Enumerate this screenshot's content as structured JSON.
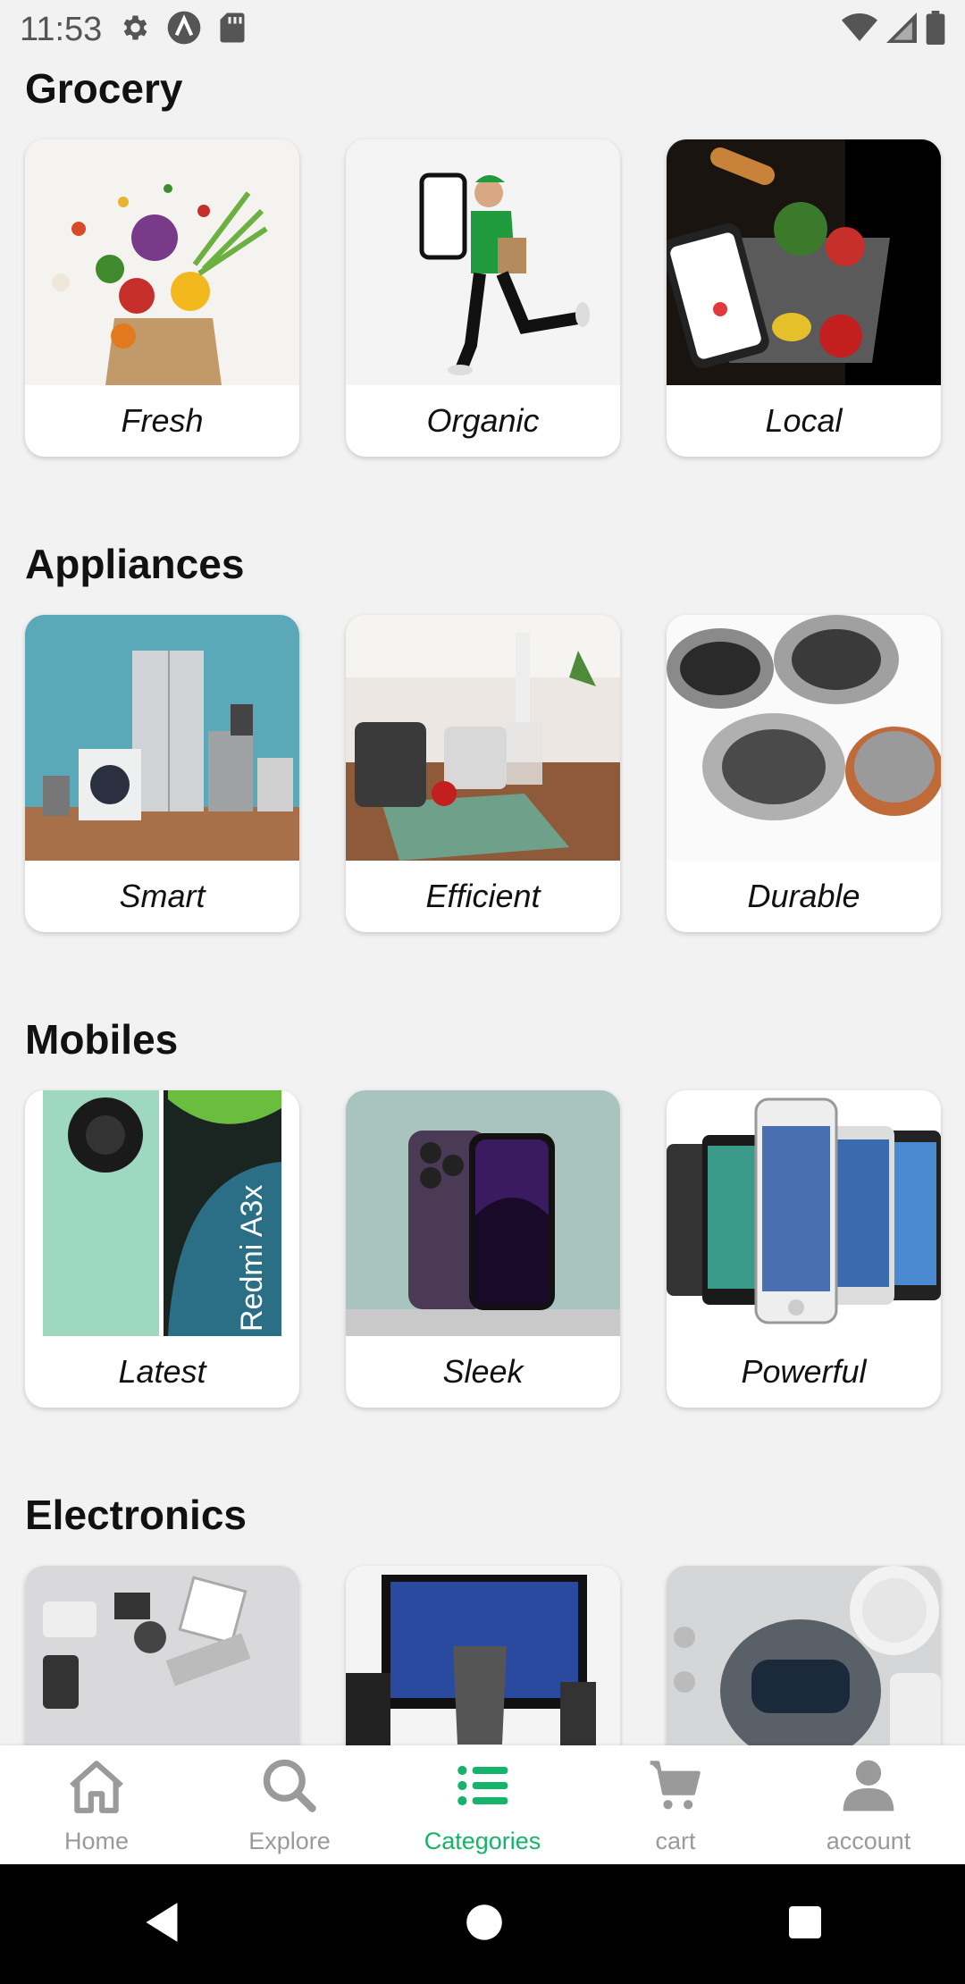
{
  "status": {
    "time": "11:53"
  },
  "sections": [
    {
      "title": "Grocery",
      "cards": [
        {
          "label": "Fresh"
        },
        {
          "label": "Organic"
        },
        {
          "label": "Local"
        }
      ]
    },
    {
      "title": "Appliances",
      "cards": [
        {
          "label": "Smart"
        },
        {
          "label": "Efficient"
        },
        {
          "label": "Durable"
        }
      ]
    },
    {
      "title": "Mobiles",
      "cards": [
        {
          "label": "Latest"
        },
        {
          "label": "Sleek"
        },
        {
          "label": "Powerful"
        }
      ]
    },
    {
      "title": "Electronics",
      "cards": [
        {
          "label": ""
        },
        {
          "label": ""
        },
        {
          "label": ""
        }
      ]
    }
  ],
  "mobiles_brand_text": "Redmi A3x",
  "nav": {
    "items": [
      {
        "label": "Home",
        "icon": "home-icon"
      },
      {
        "label": "Explore",
        "icon": "search-icon"
      },
      {
        "label": "Categories",
        "icon": "list-icon"
      },
      {
        "label": "cart",
        "icon": "cart-icon"
      },
      {
        "label": "account",
        "icon": "person-icon"
      }
    ],
    "active_color": "#16b36b",
    "inactive_color": "#9a9a9a"
  }
}
